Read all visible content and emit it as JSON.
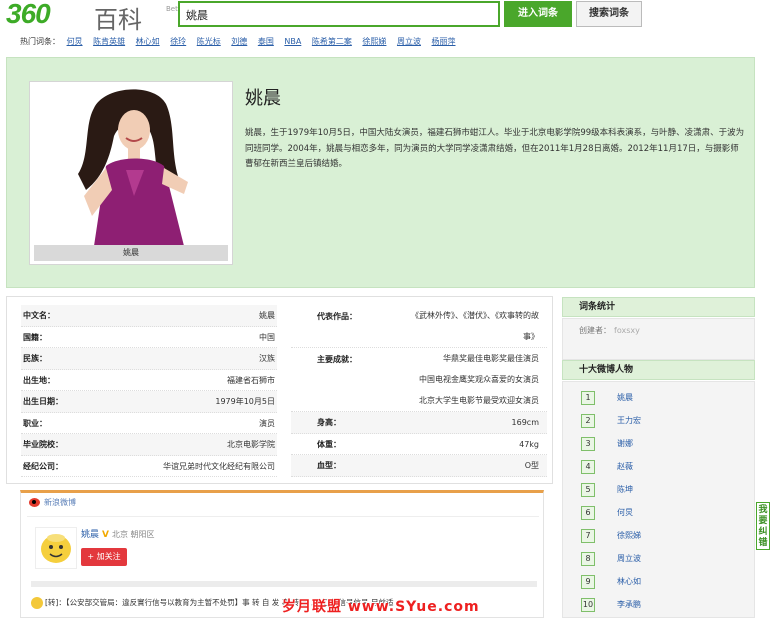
{
  "header": {
    "logo_num": "360",
    "logo_cn": "百科",
    "logo_beta": "Beta",
    "search_value": "姚晨",
    "enter_label": "进入词条",
    "search_label": "搜索词条"
  },
  "hot": {
    "label": "热门词条：",
    "items": [
      "何炅",
      "陈肯英雄",
      "林心如",
      "徐玲",
      "陈光标",
      "刘德",
      "泰国",
      "NBA",
      "陈希第二案",
      "徐熙娣",
      "周立波",
      "杨丽萍"
    ]
  },
  "hero": {
    "name": "姚晨",
    "photo_caption": "姚晨",
    "summary": "姚晨，生于1979年10月5日，中国大陆女演员，福建石狮市蚶江人。毕业于北京电影学院99级本科表演系，与叶静、凌潇肃、于波为同班同学。2004年，姚晨与相恋多年，同为演员的大学同学凌潇肃结婚，但在2011年1月28日离婚。2012年11月17日，与摄影师曹郁在新西兰皇后镇结婚。"
  },
  "info": {
    "left": [
      {
        "k": "中文名：",
        "v": "姚晨"
      },
      {
        "k": "国籍：",
        "v": "中国"
      },
      {
        "k": "民族：",
        "v": "汉族"
      },
      {
        "k": "出生地：",
        "v": "福建省石狮市"
      },
      {
        "k": "出生日期：",
        "v": "1979年10月5日"
      },
      {
        "k": "职业：",
        "v": "演员"
      },
      {
        "k": "毕业院校：",
        "v": "北京电影学院"
      },
      {
        "k": "经纪公司：",
        "v": "华谊兄弟时代文化经纪有限公司"
      }
    ],
    "works_label": "代表作品：",
    "works_lines": [
      "《武林外传》、《潜伏》、《欢事转的故",
      "事》"
    ],
    "awards_label": "主要成就：",
    "awards_lines": [
      "华鼎奖最佳电影奖最佳演员",
      "中国电视金鹰奖观众喜爱的女演员",
      "北京大学生电影节最受欢迎女演员"
    ],
    "right_rows": [
      {
        "k": "身高：",
        "v": "169cm"
      },
      {
        "k": "体重：",
        "v": "47kg"
      },
      {
        "k": "血型：",
        "v": "O型"
      }
    ]
  },
  "weibo": {
    "header": "新浪微博",
    "name": "姚晨",
    "v_mark": "V",
    "location": "北京 朝阳区",
    "follow": "+ 加关注",
    "post": "[转]：【公安部交管局：違反實行信号以教育为主暂不处罚】事 转 自 发 事 转 自 发 工作 信号信号 目前适"
  },
  "sidebar": {
    "stats_title": "词条统计",
    "creator_label": "创建者：",
    "creator_name": "foxsxy",
    "top_title": "十大微博人物",
    "top": [
      {
        "n": "1",
        "name": "姚晨"
      },
      {
        "n": "2",
        "name": "王力宏"
      },
      {
        "n": "3",
        "name": "谢娜"
      },
      {
        "n": "4",
        "name": "赵薇"
      },
      {
        "n": "5",
        "name": "陈坤"
      },
      {
        "n": "6",
        "name": "何炅"
      },
      {
        "n": "7",
        "name": "徐熙娣"
      },
      {
        "n": "8",
        "name": "周立波"
      },
      {
        "n": "9",
        "name": "林心如"
      },
      {
        "n": "10",
        "name": "李承鹏"
      }
    ]
  },
  "feedback": "我要纠错",
  "watermark": "岁月联盟 www.SYue.com",
  "colors": {
    "brand_green": "#4aa72b",
    "hero_bg": "#d9f0d5",
    "link_blue": "#2a5ea8",
    "follow_red": "#e3383d"
  }
}
